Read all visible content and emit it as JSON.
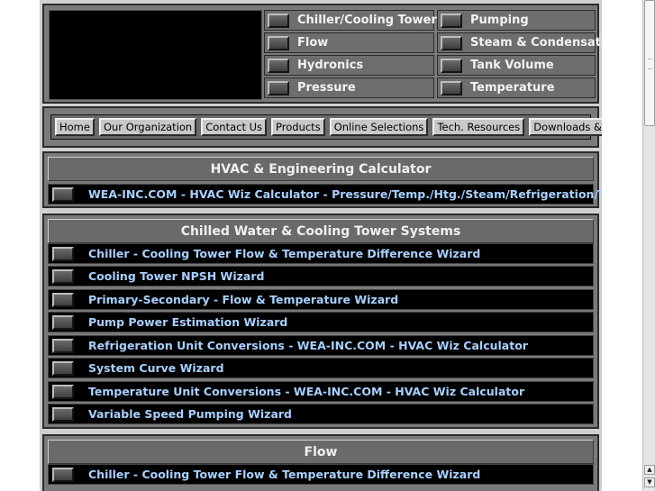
{
  "categories": {
    "col1": [
      {
        "label": "Chiller/Cooling Tower"
      },
      {
        "label": "Flow"
      },
      {
        "label": "Hydronics"
      },
      {
        "label": "Pressure"
      }
    ],
    "col2": [
      {
        "label": "Pumping"
      },
      {
        "label": "Steam & Condensate"
      },
      {
        "label": "Tank Volume"
      },
      {
        "label": "Temperature"
      }
    ]
  },
  "nav": [
    {
      "label": "Home"
    },
    {
      "label": "Our Organization"
    },
    {
      "label": "Contact Us"
    },
    {
      "label": "Products"
    },
    {
      "label": "Online Selections"
    },
    {
      "label": "Tech. Resources"
    },
    {
      "label": "Downloads & CDs"
    }
  ],
  "sections": [
    {
      "title": "HVAC & Engineering Calculator",
      "items": [
        {
          "label": "WEA-INC.COM - HVAC Wiz Calculator - Pressure/Temp./Htg./Steam/Refrigeration/Trig."
        }
      ]
    },
    {
      "title": "Chilled Water & Cooling Tower Systems",
      "items": [
        {
          "label": "Chiller - Cooling Tower  Flow & Temperature Difference Wizard"
        },
        {
          "label": "Cooling Tower NPSH Wizard"
        },
        {
          "label": "Primary-Secondary - Flow & Temperature  Wizard"
        },
        {
          "label": "Pump Power Estimation Wizard"
        },
        {
          "label": "Refrigeration Unit  Conversions - WEA-INC.COM - HVAC Wiz Calculator"
        },
        {
          "label": "System Curve Wizard"
        },
        {
          "label": "Temperature Unit  Conversions - WEA-INC.COM -  HVAC Wiz Calculator"
        },
        {
          "label": "Variable Speed  Pumping Wizard"
        }
      ]
    },
    {
      "title": "Flow",
      "items": [
        {
          "label": "Chiller - Cooling Tower  Flow & Temperature Difference Wizard"
        }
      ]
    }
  ],
  "scrollbar": {
    "up_arrow": "▲",
    "down_arrow": "▼"
  }
}
